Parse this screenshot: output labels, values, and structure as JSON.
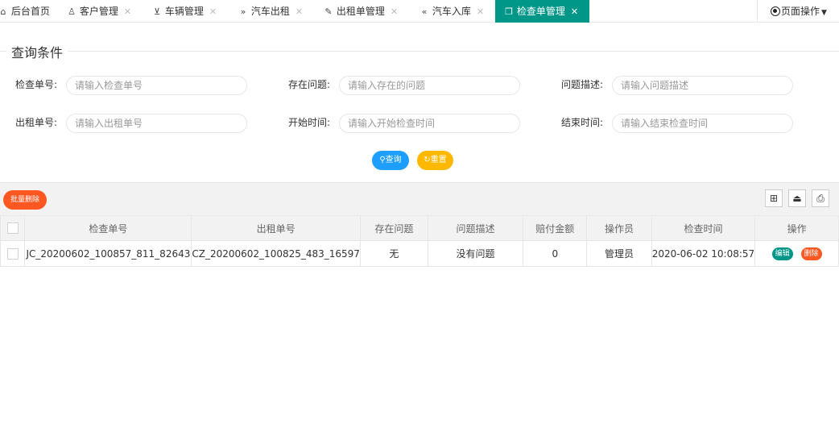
{
  "tabs": [
    {
      "label": "后台首页",
      "icon": "home-icon",
      "active": false,
      "closable": false
    },
    {
      "label": "客户管理",
      "icon": "user-icon",
      "active": false,
      "closable": true
    },
    {
      "label": "车辆管理",
      "icon": "cart-icon",
      "active": false,
      "closable": true
    },
    {
      "label": "汽车出租",
      "icon": "double-right-icon",
      "active": false,
      "closable": true
    },
    {
      "label": "出租单管理",
      "icon": "form-icon",
      "active": false,
      "closable": true
    },
    {
      "label": "汽车入库",
      "icon": "double-left-icon",
      "active": false,
      "closable": true
    },
    {
      "label": "检查单管理",
      "icon": "book-icon",
      "active": true,
      "closable": true
    }
  ],
  "page_ops_label": "页面操作",
  "query": {
    "legend": "查询条件",
    "fields": [
      {
        "label": "检查单号:",
        "placeholder": "请输入检查单号"
      },
      {
        "label": "存在问题:",
        "placeholder": "请输入存在的问题"
      },
      {
        "label": "问题描述:",
        "placeholder": "请输入问题描述"
      },
      {
        "label": "出租单号:",
        "placeholder": "请输入出租单号"
      },
      {
        "label": "开始时间:",
        "placeholder": "请输入开始检查时间"
      },
      {
        "label": "结束时间:",
        "placeholder": "请输入结束检查时间"
      }
    ],
    "search_label": "查询",
    "reset_label": "重置"
  },
  "toolbar": {
    "batch_delete_label": "批量删除",
    "icons": [
      "columns-icon",
      "export-icon",
      "print-icon"
    ]
  },
  "table": {
    "columns": [
      "检查单号",
      "出租单号",
      "存在问题",
      "问题描述",
      "赔付金额",
      "操作员",
      "检查时间",
      "操作"
    ],
    "rows": [
      [
        "JC_20200602_100857_811_82643",
        "CZ_20200602_100825_483_16597",
        "无",
        "没有问题",
        "0",
        "管理员",
        "2020-06-02 10:08:57"
      ]
    ],
    "edit_label": "编辑",
    "delete_label": "删除"
  },
  "colors": {
    "accent": "#009688",
    "blue": "#1e9fff",
    "yellow": "#ffb800",
    "danger": "#ff5722"
  }
}
